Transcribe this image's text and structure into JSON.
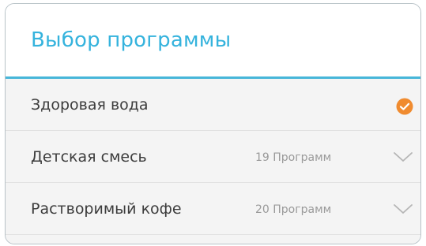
{
  "dialog": {
    "title": "Выбор программы"
  },
  "programs": [
    {
      "label": "Здоровая вода",
      "count": "",
      "selected": true,
      "icon": "check-circle-icon"
    },
    {
      "label": "Детская смесь",
      "count": "19 Программ",
      "selected": false,
      "icon": "chevron-down-icon"
    },
    {
      "label": "Растворимый кофе",
      "count": "20 Программ",
      "selected": false,
      "icon": "chevron-down-icon"
    }
  ],
  "colors": {
    "accent": "#35b3dd",
    "divider": "#47b6d9",
    "check": "#f08b2f",
    "chevron": "#b5b5b5"
  }
}
